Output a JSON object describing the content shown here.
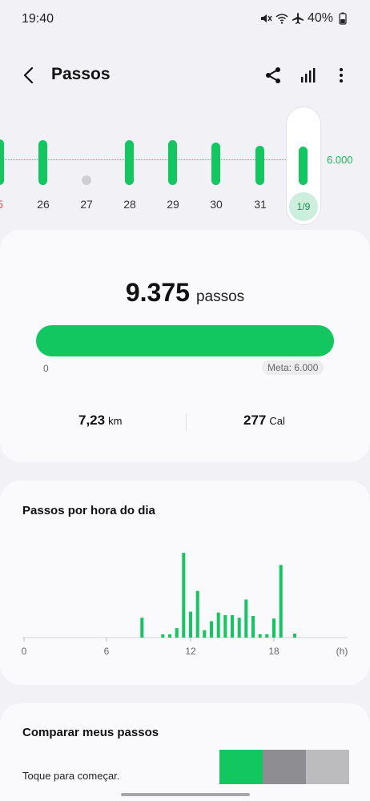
{
  "status_bar": {
    "time": "19:40",
    "battery": "40%",
    "icons": [
      "mute-icon",
      "wifi-icon",
      "airplane-icon",
      "battery-icon"
    ]
  },
  "app_bar": {
    "title": "Passos",
    "back_icon": "chevron-left-icon",
    "actions": [
      "share-icon",
      "stats-icon",
      "more-vert-icon"
    ]
  },
  "day_strip": {
    "goal_label": "6.000",
    "accent_color": "#13c760",
    "days": [
      {
        "label": "5",
        "steps": 9000,
        "has_data": true
      },
      {
        "label": "26",
        "steps": 8600,
        "has_data": true
      },
      {
        "label": "27",
        "steps": 0,
        "has_data": false
      },
      {
        "label": "28",
        "steps": 8800,
        "has_data": true
      },
      {
        "label": "29",
        "steps": 8600,
        "has_data": true
      },
      {
        "label": "30",
        "steps": 7900,
        "has_data": true
      },
      {
        "label": "31",
        "steps": 6500,
        "has_data": true
      },
      {
        "label": "1/9",
        "steps": 6200,
        "has_data": true,
        "selected": true
      }
    ]
  },
  "summary": {
    "steps": "9.375",
    "steps_unit": "passos",
    "progress_fraction": 1.0,
    "progress_min": "0",
    "goal_label": "Meta: 6.000",
    "distance": "7,23",
    "distance_unit": "km",
    "calories": "277",
    "calories_unit": "Cal"
  },
  "hourly_card": {
    "title": "Passos por hora do dia",
    "x_unit": "(h)"
  },
  "chart_data": {
    "type": "bar",
    "title": "Passos por hora do dia",
    "x_ticks": [
      "0",
      "6",
      "12",
      "18"
    ],
    "x_unit_label": "(h)",
    "x_range": [
      0,
      23
    ],
    "y_max": 1000,
    "bars": [
      {
        "x": 8.5,
        "y": 230
      },
      {
        "x": 10.0,
        "y": 38
      },
      {
        "x": 10.5,
        "y": 38
      },
      {
        "x": 11.0,
        "y": 110
      },
      {
        "x": 11.5,
        "y": 980
      },
      {
        "x": 12.0,
        "y": 300
      },
      {
        "x": 12.5,
        "y": 540
      },
      {
        "x": 13.0,
        "y": 85
      },
      {
        "x": 13.5,
        "y": 190
      },
      {
        "x": 14.0,
        "y": 290
      },
      {
        "x": 14.5,
        "y": 260
      },
      {
        "x": 15.0,
        "y": 260
      },
      {
        "x": 15.5,
        "y": 230
      },
      {
        "x": 16.0,
        "y": 440
      },
      {
        "x": 16.5,
        "y": 250
      },
      {
        "x": 17.0,
        "y": 40
      },
      {
        "x": 17.5,
        "y": 40
      },
      {
        "x": 18.0,
        "y": 220
      },
      {
        "x": 18.5,
        "y": 840
      },
      {
        "x": 19.5,
        "y": 45
      }
    ]
  },
  "compare_card": {
    "title": "Comparar meus passos",
    "subtitle": "Toque para começar.",
    "swatches": [
      "#13c760",
      "#8d8d92",
      "#bcbcbf"
    ]
  }
}
